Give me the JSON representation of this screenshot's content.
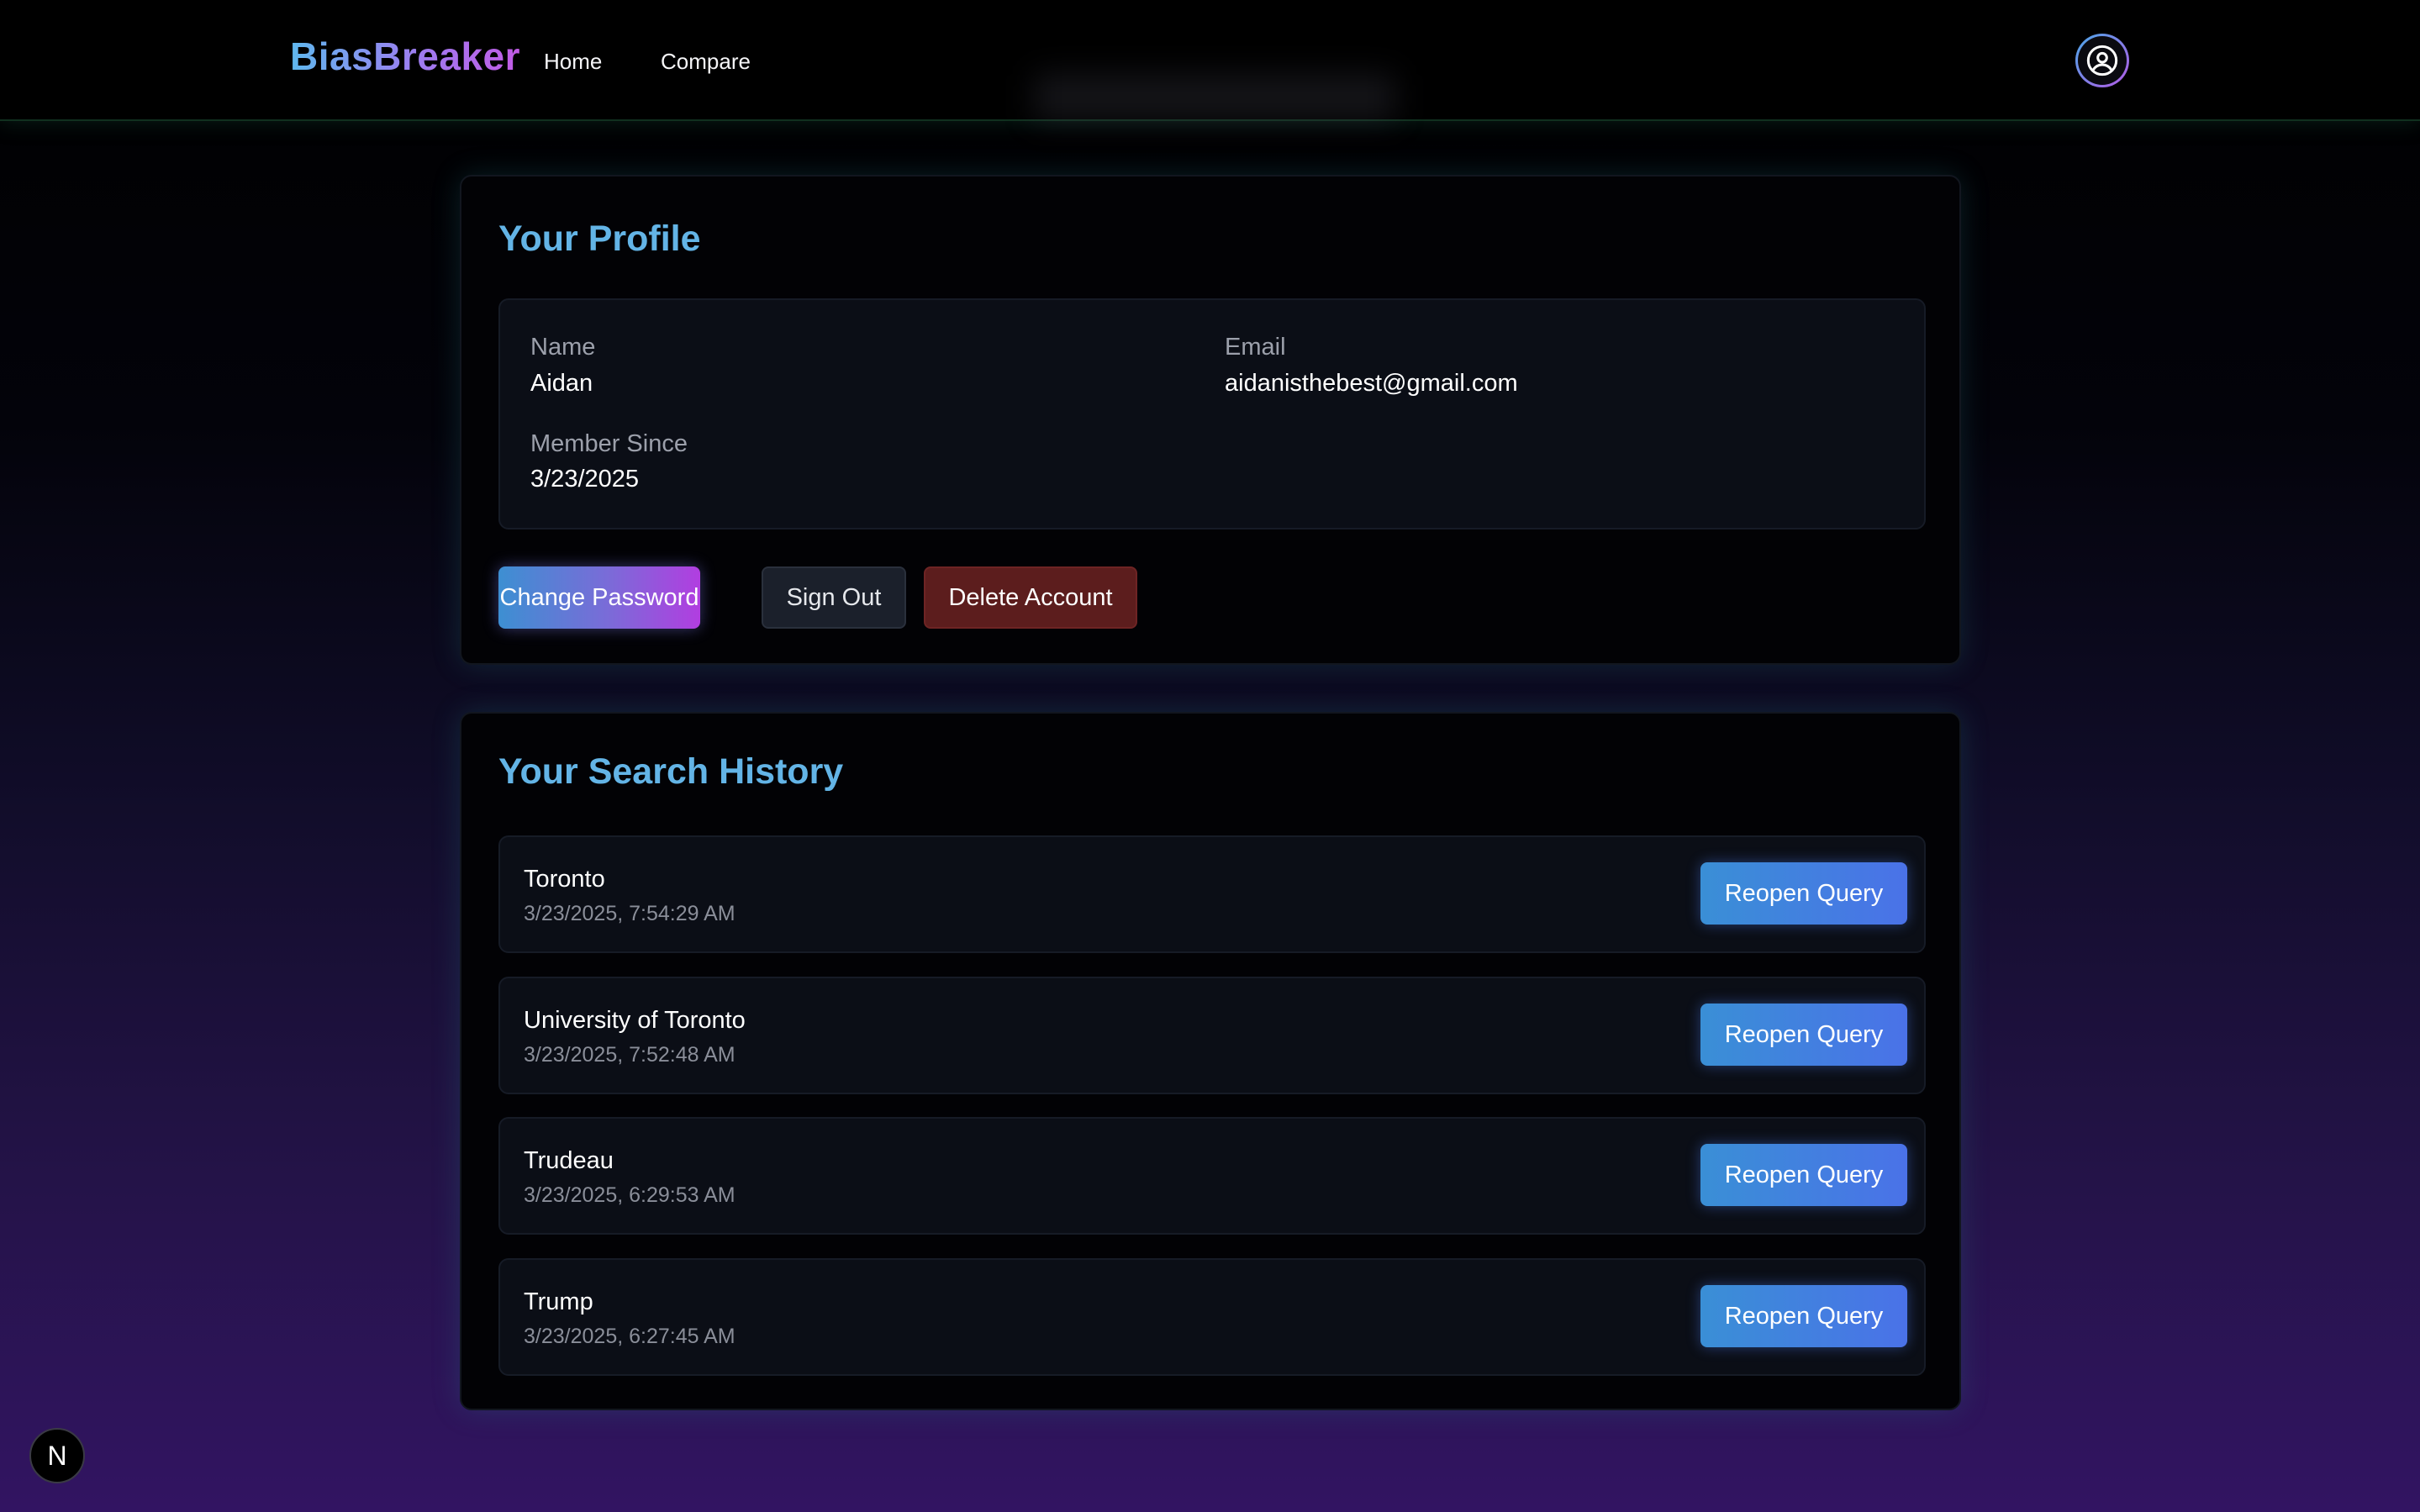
{
  "navbar": {
    "brand": "BiasBreaker",
    "links": [
      "Home",
      "Compare"
    ],
    "profile_icon": "user-circle-icon"
  },
  "profile": {
    "title": "Your Profile",
    "fields": {
      "name_label": "Name",
      "name_value": "Aidan",
      "email_label": "Email",
      "email_value": "aidanisthebest@gmail.com",
      "member_since_label": "Member Since",
      "member_since_value": "3/23/2025"
    },
    "buttons": {
      "change_password": "Change Password",
      "sign_out": "Sign Out",
      "delete_account": "Delete Account"
    }
  },
  "history": {
    "title": "Your Search History",
    "reopen_label": "Reopen Query",
    "items": [
      {
        "query": "Toronto",
        "time": "3/23/2025, 7:54:29 AM"
      },
      {
        "query": "University of Toronto",
        "time": "3/23/2025, 7:52:48 AM"
      },
      {
        "query": "Trudeau",
        "time": "3/23/2025, 6:29:53 AM"
      },
      {
        "query": "Trump",
        "time": "3/23/2025, 6:27:45 AM"
      }
    ]
  },
  "dev_badge": {
    "label": "N",
    "icon": "nextjs-icon"
  },
  "colors": {
    "accent_blue": "#63b4e6",
    "brand_gradient_start": "#5fb8ee",
    "brand_gradient_end": "#c25be6",
    "danger": "#5c1d1d",
    "card_bg": "#020205"
  }
}
